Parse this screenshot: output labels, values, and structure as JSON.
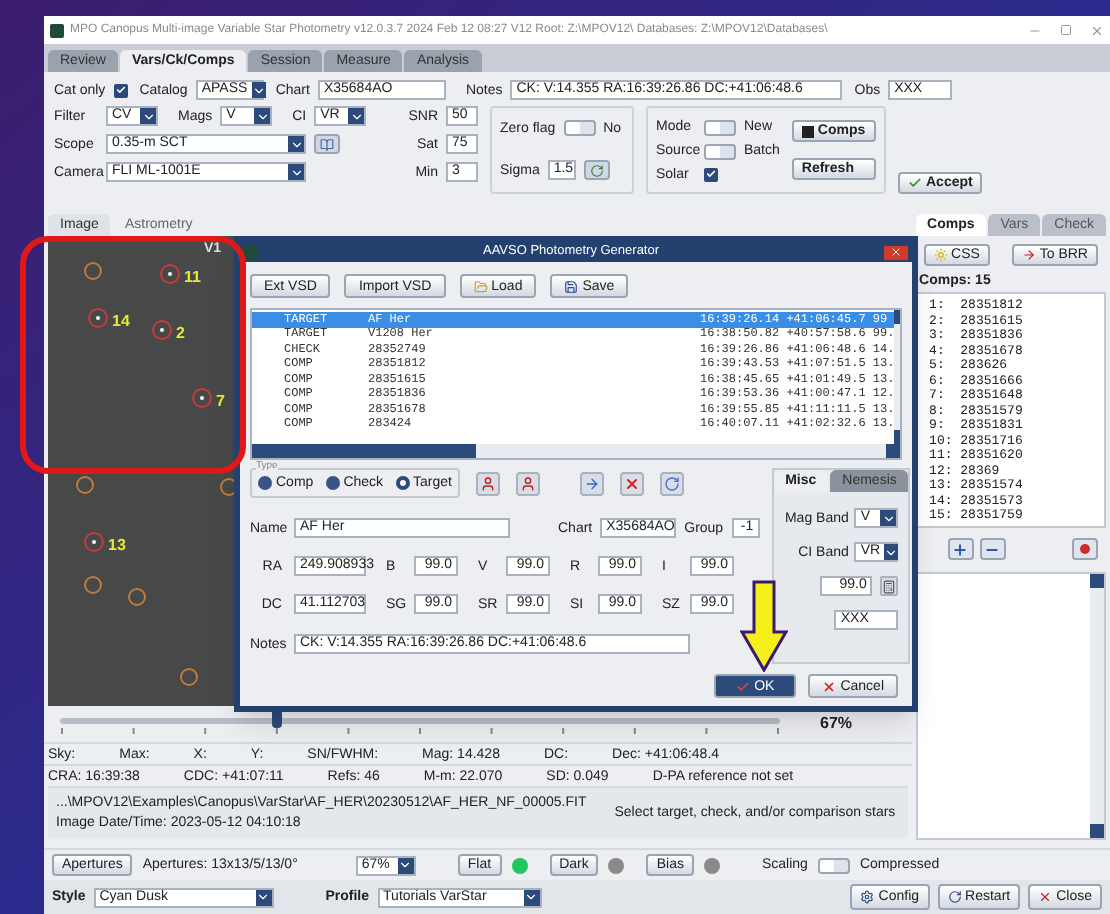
{
  "window": {
    "title": "MPO Canopus Multi-image Variable Star Photometry   v12.0.3.7  2024 Feb 12 08:27     V12 Root: Z:\\MPOV12\\     Databases: Z:\\MPOV12\\Databases\\"
  },
  "tabs": [
    {
      "label": "Review",
      "selected": false
    },
    {
      "label": "Vars/Ck/Comps",
      "selected": true
    },
    {
      "label": "Session",
      "selected": false
    },
    {
      "label": "Measure",
      "selected": false
    },
    {
      "label": "Analysis",
      "selected": false
    }
  ],
  "settings": {
    "cat_only": {
      "label": "Cat only",
      "checked": true
    },
    "catalog": {
      "label": "Catalog",
      "value": "APASS"
    },
    "chart": {
      "label": "Chart",
      "value": "X35684AO"
    },
    "notes": {
      "label": "Notes",
      "value": "CK: V:14.355 RA:16:39:26.86 DC:+41:06:48.6"
    },
    "obs": {
      "label": "Obs",
      "value": "XXX"
    },
    "filter": {
      "label": "Filter",
      "value": "CV"
    },
    "mags": {
      "label": "Mags",
      "value": "V"
    },
    "ci": {
      "label": "CI",
      "value": "VR"
    },
    "snr": {
      "label": "SNR",
      "value": "50"
    },
    "scope": {
      "label": "Scope",
      "value": "0.35-m SCT"
    },
    "sat": {
      "label": "Sat",
      "value": "75"
    },
    "camera": {
      "label": "Camera",
      "value": "FLI ML-1001E"
    },
    "min": {
      "label": "Min",
      "value": "3"
    },
    "zero_flag": {
      "label": "Zero flag",
      "on": false,
      "state_text": "No"
    },
    "sigma": {
      "label": "Sigma",
      "value": "1.5"
    },
    "mode": {
      "label": "Mode",
      "on": false,
      "state_text": "New"
    },
    "source": {
      "label": "Source",
      "on": false,
      "state_text": "Batch"
    },
    "solar": {
      "label": "Solar",
      "checked": true
    },
    "comps_button": "Comps",
    "refresh_button": "Refresh",
    "accept_button": "Accept"
  },
  "image_panel": {
    "tabs": [
      {
        "label": "Image",
        "selected": true
      },
      {
        "label": "Astrometry",
        "selected": false
      }
    ],
    "star_labels": [
      "11",
      "14",
      "2",
      "7",
      "13"
    ],
    "partial_label": "V1",
    "slider": {
      "level": 0.3,
      "reading": "67%"
    }
  },
  "readouts": [
    [
      "Sky:",
      "Max:",
      "X:",
      "Y:",
      "SN/FWHM:",
      "Mag: 14.428",
      "DC:",
      "Dec: +41:06:48.4"
    ],
    [
      "CRA: 16:39:38",
      "CDC: +41:07:11",
      "Refs: 46",
      "M-m: 22.070",
      "SD: 0.049",
      "D-PA reference not set"
    ]
  ],
  "file_info": {
    "path": "...\\MPOV12\\Examples\\Canopus\\VarStar\\AF_HER\\20230512\\AF_HER_NF_00005.FIT",
    "datetime": "Image Date/Time: 2023-05-12  04:10:18",
    "message": "Select target, check, and/or comparison stars"
  },
  "comps_panel": {
    "tabs": [
      {
        "label": "Comps",
        "selected": true
      },
      {
        "label": "Vars",
        "selected": false
      },
      {
        "label": "Check",
        "selected": false
      }
    ],
    "css_button": "CSS",
    "brr_button": "To BRR",
    "title": "Comps: 15",
    "items": [
      "1:  28351812",
      "2:  28351615",
      "3:  28351836",
      "4:  28351678",
      "5:  283626",
      "6:  28351666",
      "7:  28351648",
      "8:  28351579",
      "9:  28351831",
      "10: 28351716",
      "11: 28351620",
      "12: 28369",
      "13: 28351574",
      "14: 28351573",
      "15: 28351759"
    ]
  },
  "bottom_bar": {
    "apertures_button": "Apertures",
    "apertures_text": "Apertures: 13x13/5/13/0°",
    "zoom": "67%",
    "calibrations": [
      {
        "label": "Flat",
        "color": "#22c55e"
      },
      {
        "label": "Dark",
        "color": "#8a8a8a"
      },
      {
        "label": "Bias",
        "color": "#8a8a8a"
      }
    ],
    "scaling": {
      "label": "Scaling",
      "on": false,
      "state_text": "Compressed"
    },
    "style": {
      "label": "Style",
      "value": "Cyan Dusk"
    },
    "profile": {
      "label": "Profile",
      "value": "Tutorials VarStar"
    },
    "buttons": [
      {
        "label": "Config",
        "kind": "config"
      },
      {
        "label": "Restart",
        "kind": "restart"
      },
      {
        "label": "Close",
        "kind": "close"
      }
    ]
  },
  "dialog": {
    "title": "AAVSO Photometry Generator",
    "toolbar": [
      {
        "label": "Ext VSD",
        "kind": "plain"
      },
      {
        "label": "Import VSD",
        "kind": "plain"
      },
      {
        "label": "Load",
        "kind": "load"
      },
      {
        "label": "Save",
        "kind": "save"
      }
    ],
    "rows": [
      {
        "type": "TARGET",
        "name": "AF Her",
        "coords": "16:39:26.14 +41:06:45.7 99",
        "selected": true
      },
      {
        "type": "TARGET",
        "name": "V1208 Her",
        "coords": "16:38:50.82 +40:57:58.6 99.",
        "selected": false
      },
      {
        "type": "CHECK",
        "name": "28352749",
        "coords": "16:39:26.86 +41:06:48.6 14.",
        "selected": false
      },
      {
        "type": "COMP",
        "name": "28351812",
        "coords": "16:39:43.53 +41:07:51.5 13.",
        "selected": false
      },
      {
        "type": "COMP",
        "name": "28351615",
        "coords": "16:38:45.65 +41:01:49.5 13.",
        "selected": false
      },
      {
        "type": "COMP",
        "name": "28351836",
        "coords": "16:39:53.36 +41:00:47.1 12.",
        "selected": false
      },
      {
        "type": "COMP",
        "name": "28351678",
        "coords": "16:39:55.85 +41:11:11.5 13.",
        "selected": false
      },
      {
        "type": "COMP",
        "name": "283424",
        "coords": "16:40:07.11 +41:02:32.6 13.",
        "selected": false
      }
    ],
    "type_group": {
      "label": "Type",
      "options": [
        {
          "label": "Comp",
          "selected": false
        },
        {
          "label": "Check",
          "selected": false
        },
        {
          "label": "Target",
          "selected": true
        }
      ]
    },
    "name": {
      "label": "Name",
      "value": "AF Her"
    },
    "chart": {
      "label": "Chart",
      "value": "X35684AO"
    },
    "group": {
      "label": "Group",
      "value": "-1"
    },
    "ra": {
      "label": "RA",
      "value": "249.908933"
    },
    "dc": {
      "label": "DC",
      "value": "41.112703"
    },
    "mags_row1": [
      {
        "label": "B",
        "value": "99.0"
      },
      {
        "label": "V",
        "value": "99.0"
      },
      {
        "label": "R",
        "value": "99.0"
      },
      {
        "label": "I",
        "value": "99.0"
      }
    ],
    "mags_row2": [
      {
        "label": "SG",
        "value": "99.0"
      },
      {
        "label": "SR",
        "value": "99.0"
      },
      {
        "label": "SI",
        "value": "99.0"
      },
      {
        "label": "SZ",
        "value": "99.0"
      }
    ],
    "notes": {
      "label": "Notes",
      "value": "CK: V:14.355 RA:16:39:26.86 DC:+41:06:48.6"
    },
    "side_tabs": [
      {
        "label": "Misc",
        "selected": true
      },
      {
        "label": "Nemesis",
        "selected": false
      }
    ],
    "mag_band": {
      "label": "Mag Band",
      "value": "V"
    },
    "ci_band": {
      "label": "CI Band",
      "value": "VR"
    },
    "misc_value": "99.0",
    "obs_value": "XXX",
    "ok_button": "OK",
    "cancel_button": "Cancel"
  }
}
